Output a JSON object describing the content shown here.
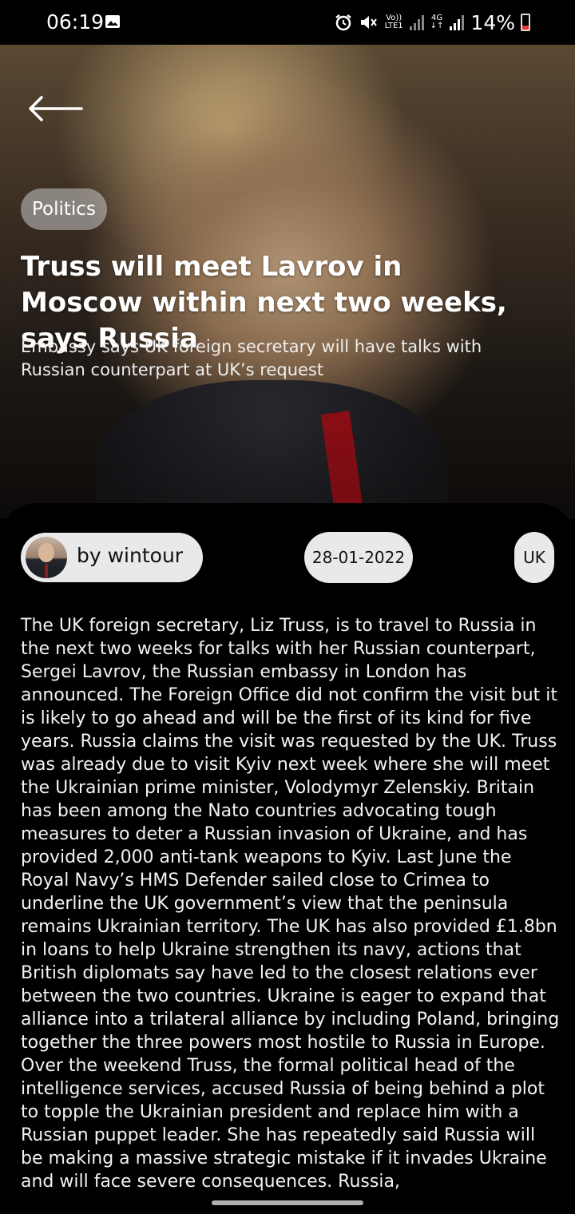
{
  "status_bar": {
    "time": "06:19",
    "network_top": "Vo))",
    "network_bottom": "LTE1",
    "data_top": "4G",
    "data_bottom": "↓↑",
    "battery": "14%",
    "icons": [
      "image-icon",
      "alarm-icon",
      "mute-icon",
      "signal-icon",
      "battery-icon"
    ]
  },
  "article": {
    "category": "Politics",
    "title": "Truss will meet Lavrov in Moscow within next two weeks, says Russia",
    "subtitle": "Embassy says UK foreign secretary will have talks with Russian counterpart at UK’s request",
    "author": "by wintour",
    "date": "28-01-2022",
    "region": "UK",
    "body": "The UK foreign secretary, Liz Truss, is to travel to Russia in the next two weeks for talks with her Russian counterpart, Sergei Lavrov, the Russian embassy in London has announced. The Foreign Office did not confirm the visit but it is likely to go ahead and will be the first of its kind for five years. Russia claims the visit was requested by the UK. Truss was already due to visit Kyiv next week where she will meet the Ukrainian prime minister, Volodymyr Zelenskiy. Britain has been among the Nato countries advocating tough measures to deter a Russian invasion of Ukraine, and has provided 2,000 anti-tank weapons to Kyiv. Last June the Royal Navy’s HMS Defender sailed close to Crimea to underline the UK government’s view that the peninsula remains Ukrainian territory. The UK has also provided £1.8bn in loans to help Ukraine strengthen its navy, actions that British diplomats say have led to the closest relations ever between the two countries. Ukraine is eager to expand that alliance into a trilateral alliance by including Poland, bringing together the three powers most hostile to Russia in Europe. Over the weekend Truss, the formal political head of the intelligence services, accused Russia of being behind a plot to topple the Ukrainian president and replace him with a Russian puppet leader. She has repeatedly said Russia will be making a massive strategic mistake if it invades Ukraine and will face severe consequences. Russia,"
  },
  "colors": {
    "background": "#000000",
    "chip": "#e9e9e9",
    "text": "#ffffff",
    "battery_low": "#e53935"
  }
}
